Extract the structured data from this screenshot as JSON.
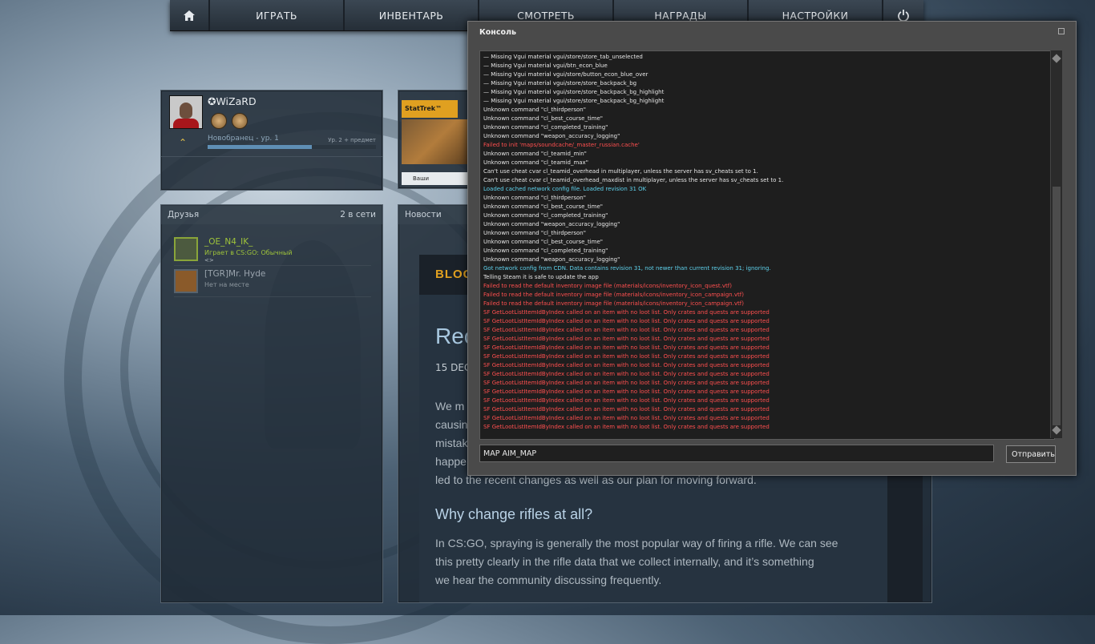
{
  "nav": {
    "home_icon": "home-icon",
    "items": [
      "ИГРАТЬ",
      "ИНВЕНТАРЬ",
      "СМОТРЕТЬ",
      "НАГРАДЫ",
      "НАСТРОЙКИ"
    ],
    "power_icon": "power-icon"
  },
  "profile": {
    "name": "✪WiZaRD",
    "rank_label": "Новобранец - ур. 1",
    "rank_next": "Ур. 2 + предмет",
    "xp_progress": 0.62
  },
  "friends": {
    "title": "Друзья",
    "online_count": "2 в сети",
    "list": [
      {
        "name": "_OE_N4_IK_",
        "status": "Играет в CS:GO: Обычный",
        "extra": "<>"
      },
      {
        "name": "[TGR]Mr. Hyde",
        "status": "Нет на месте",
        "extra": ""
      }
    ]
  },
  "store": {
    "badge": "StatTrek™",
    "caption": "Ваши предложения"
  },
  "news": {
    "title": "Новости",
    "blog_label": "BLOG",
    "article_title": "Rec",
    "date": "15 DEC",
    "para1": [
      "We m",
      "causin",
      "mistak",
      "happe",
      "led to the recent changes as well as our plan for moving forward."
    ],
    "h2": "Why change rifles at all?",
    "para2": [
      "In CS:GO, spraying is generally the most popular way of firing a rifle. We can see",
      "this pretty clearly in the rifle data that we collect internally, and it’s something",
      "we hear the community discussing frequently."
    ]
  },
  "console": {
    "title": "Консоль",
    "input_value": "MAP AIM_MAP",
    "submit_label": "Отправить",
    "colors": {
      "white": "#e6e6e6",
      "red": "#ff4f4f",
      "cyan": "#5fd3ee"
    },
    "lines": [
      {
        "t": "— Missing Vgui material vgui/store/store_tab_unselected",
        "c": "white"
      },
      {
        "t": "— Missing Vgui material vgui/btn_econ_blue",
        "c": "white"
      },
      {
        "t": "— Missing Vgui material vgui/store/button_econ_blue_over",
        "c": "white"
      },
      {
        "t": "— Missing Vgui material vgui/store/store_backpack_bg",
        "c": "white"
      },
      {
        "t": "— Missing Vgui material vgui/store/store_backpack_bg_highlight",
        "c": "white"
      },
      {
        "t": "— Missing Vgui material vgui/store/store_backpack_bg_highlight",
        "c": "white"
      },
      {
        "t": "Unknown command \"cl_thirdperson\"",
        "c": "white"
      },
      {
        "t": "Unknown command \"cl_best_course_time\"",
        "c": "white"
      },
      {
        "t": "Unknown command \"cl_completed_training\"",
        "c": "white"
      },
      {
        "t": "Unknown command \"weapon_accuracy_logging\"",
        "c": "white"
      },
      {
        "t": "Failed to init 'maps/soundcache/_master_russian.cache'",
        "c": "red"
      },
      {
        "t": "Unknown command \"cl_teamid_min\"",
        "c": "white"
      },
      {
        "t": "Unknown command \"cl_teamid_max\"",
        "c": "white"
      },
      {
        "t": "Can't use cheat cvar cl_teamid_overhead in multiplayer, unless the server has sv_cheats set to 1.",
        "c": "white"
      },
      {
        "t": "Can't use cheat cvar cl_teamid_overhead_maxdist in multiplayer, unless the server has sv_cheats set to 1.",
        "c": "white"
      },
      {
        "t": "Loaded cached network config file.  Loaded revision 31 OK",
        "c": "cyan"
      },
      {
        "t": "Unknown command \"cl_thirdperson\"",
        "c": "white"
      },
      {
        "t": "Unknown command \"cl_best_course_time\"",
        "c": "white"
      },
      {
        "t": "Unknown command \"cl_completed_training\"",
        "c": "white"
      },
      {
        "t": "Unknown command \"weapon_accuracy_logging\"",
        "c": "white"
      },
      {
        "t": "Unknown command \"cl_thirdperson\"",
        "c": "white"
      },
      {
        "t": "Unknown command \"cl_best_course_time\"",
        "c": "white"
      },
      {
        "t": "Unknown command \"cl_completed_training\"",
        "c": "white"
      },
      {
        "t": "Unknown command \"weapon_accuracy_logging\"",
        "c": "white"
      },
      {
        "t": "Got network config from CDN.  Data contains revision 31, not newer than current revision 31; ignoring.",
        "c": "cyan"
      },
      {
        "t": "Telling Steam it is safe to update the app",
        "c": "white"
      },
      {
        "t": "Failed to read the default inventory image file (materials/icons/inventory_icon_quest.vtf)",
        "c": "red"
      },
      {
        "t": "Failed to read the default inventory image file (materials/icons/inventory_icon_campaign.vtf)",
        "c": "red"
      },
      {
        "t": "Failed to read the default inventory image file (materials/icons/inventory_icon_campaign.vtf)",
        "c": "red"
      },
      {
        "t": "SF GetLootListItemIdByIndex called on an item with no loot list. Only crates and quests are supported",
        "c": "red"
      },
      {
        "t": "SF GetLootListItemIdByIndex called on an item with no loot list. Only crates and quests are supported",
        "c": "red"
      },
      {
        "t": "SF GetLootListItemIdByIndex called on an item with no loot list. Only crates and quests are supported",
        "c": "red"
      },
      {
        "t": "SF GetLootListItemIdByIndex called on an item with no loot list. Only crates and quests are supported",
        "c": "red"
      },
      {
        "t": "SF GetLootListItemIdByIndex called on an item with no loot list. Only crates and quests are supported",
        "c": "red"
      },
      {
        "t": "SF GetLootListItemIdByIndex called on an item with no loot list. Only crates and quests are supported",
        "c": "red"
      },
      {
        "t": "SF GetLootListItemIdByIndex called on an item with no loot list. Only crates and quests are supported",
        "c": "red"
      },
      {
        "t": "SF GetLootListItemIdByIndex called on an item with no loot list. Only crates and quests are supported",
        "c": "red"
      },
      {
        "t": "SF GetLootListItemIdByIndex called on an item with no loot list. Only crates and quests are supported",
        "c": "red"
      },
      {
        "t": "SF GetLootListItemIdByIndex called on an item with no loot list. Only crates and quests are supported",
        "c": "red"
      },
      {
        "t": "SF GetLootListItemIdByIndex called on an item with no loot list. Only crates and quests are supported",
        "c": "red"
      },
      {
        "t": "SF GetLootListItemIdByIndex called on an item with no loot list. Only crates and quests are supported",
        "c": "red"
      },
      {
        "t": "SF GetLootListItemIdByIndex called on an item with no loot list. Only crates and quests are supported",
        "c": "red"
      },
      {
        "t": "SF GetLootListItemIdByIndex called on an item with no loot list. Only crates and quests are supported",
        "c": "red"
      }
    ]
  }
}
